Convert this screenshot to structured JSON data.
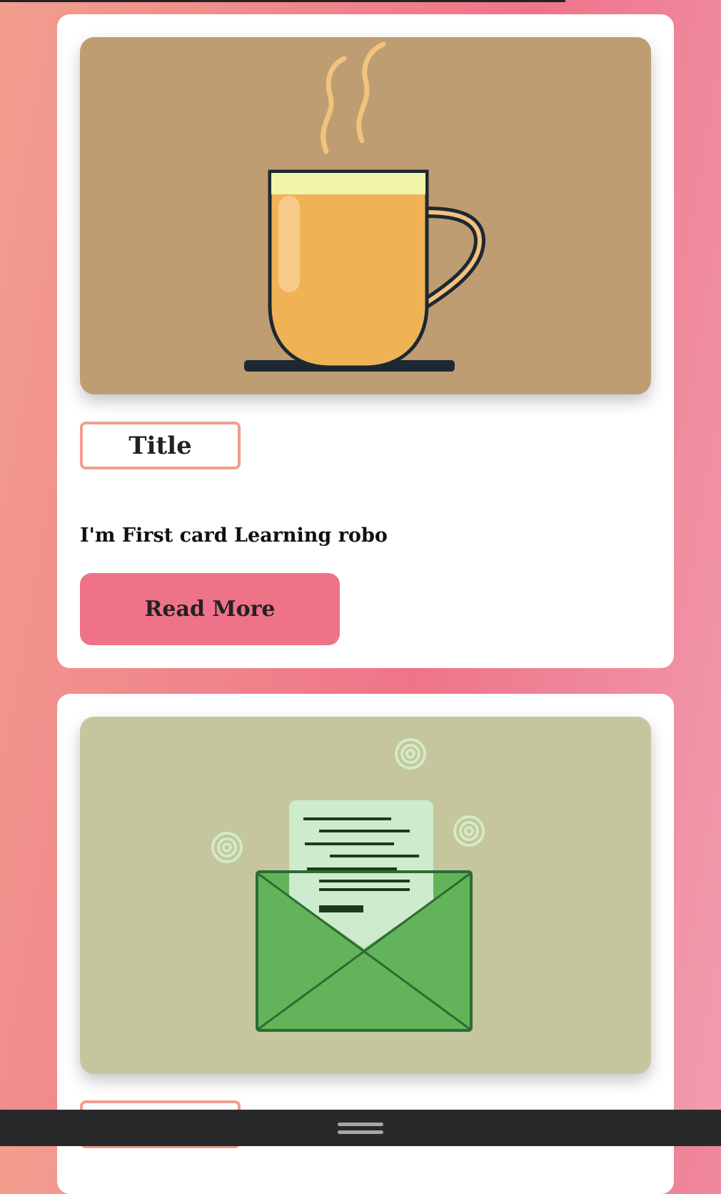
{
  "cards": [
    {
      "title": "Title",
      "description": "I'm First card Learning robo",
      "button": "Read More",
      "image": "coffee-mug-illustration",
      "image_bg": "#bf9d72"
    },
    {
      "title": "Title",
      "image": "envelope-letter-illustration",
      "image_bg": "#c5c69e"
    }
  ]
}
